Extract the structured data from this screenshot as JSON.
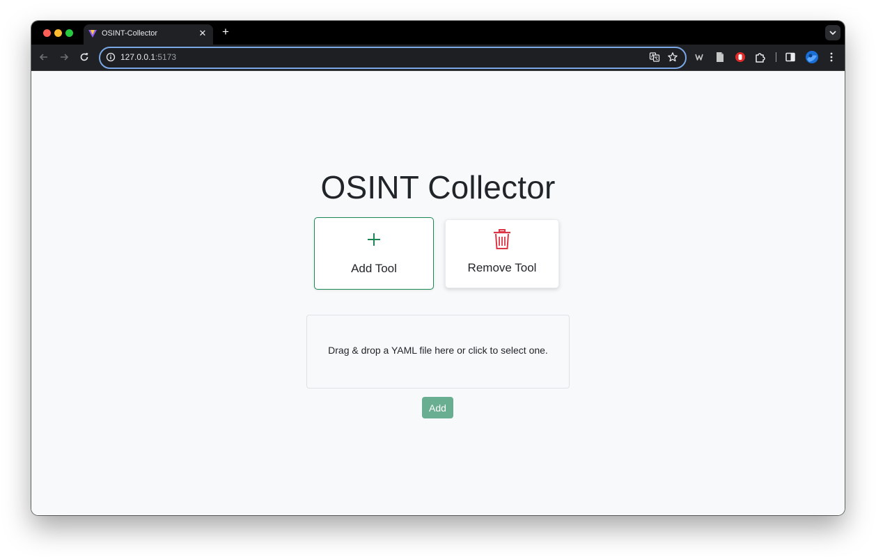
{
  "browser": {
    "tab": {
      "title": "OSINT-Collector"
    },
    "url": {
      "host": "127.0.0.1",
      "port": ":5173"
    }
  },
  "page": {
    "title": "OSINT Collector",
    "cards": {
      "add": {
        "label": "Add Tool"
      },
      "remove": {
        "label": "Remove Tool"
      }
    },
    "dropzone": {
      "text": "Drag & drop a YAML file here or click to select one."
    },
    "add_button": {
      "label": "Add"
    }
  },
  "colors": {
    "success": "#198754",
    "danger": "#dc3545",
    "add_button_bg": "#6aae91",
    "page_bg": "#f8f9fa"
  },
  "icons": {
    "tabstrip": [
      "favicon-icon",
      "close-icon",
      "plus-icon",
      "chevron-down-icon"
    ],
    "toolbar": [
      "back-arrow-icon",
      "forward-arrow-icon",
      "reload-icon",
      "info-icon",
      "translate-icon",
      "star-icon",
      "extension-w-icon",
      "document-icon",
      "red-extension-icon",
      "puzzle-icon",
      "side-panel-icon",
      "profile-avatar-icon",
      "kebab-menu-icon"
    ],
    "cards": [
      "plus-icon",
      "trash-icon"
    ]
  }
}
